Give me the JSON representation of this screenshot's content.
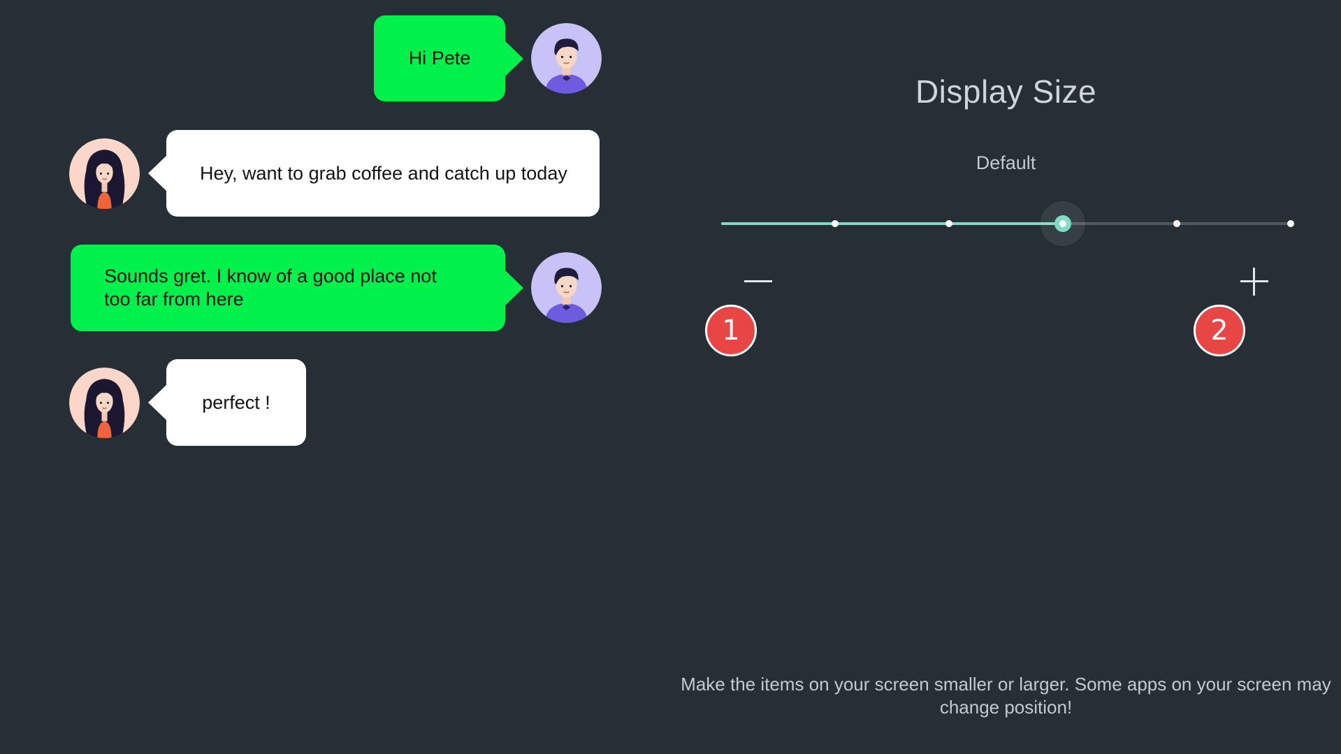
{
  "chat": {
    "messages": [
      {
        "sender": "me",
        "text": "Hi Pete"
      },
      {
        "sender": "other",
        "text": "Hey, want to grab coffee and catch up today"
      },
      {
        "sender": "me",
        "text": "Sounds gret. I know of a good place not too far from here"
      },
      {
        "sender": "other",
        "text": "perfect !"
      }
    ],
    "colors": {
      "sent_bubble": "#00f04c",
      "received_bubble": "#ffffff",
      "background": "#252f35"
    }
  },
  "settings": {
    "title": "Display Size",
    "current_value": "Default",
    "slider": {
      "steps": 5,
      "selected_index": 2,
      "accent": "#7fdcc2"
    },
    "decrease_icon": "minus-icon",
    "increase_icon": "plus-icon",
    "markers": [
      {
        "label": "1",
        "color": "#e84545"
      },
      {
        "label": "2",
        "color": "#e84545"
      }
    ],
    "description": "Make the items on your screen smaller or larger. Some apps on your screen may change position!"
  }
}
